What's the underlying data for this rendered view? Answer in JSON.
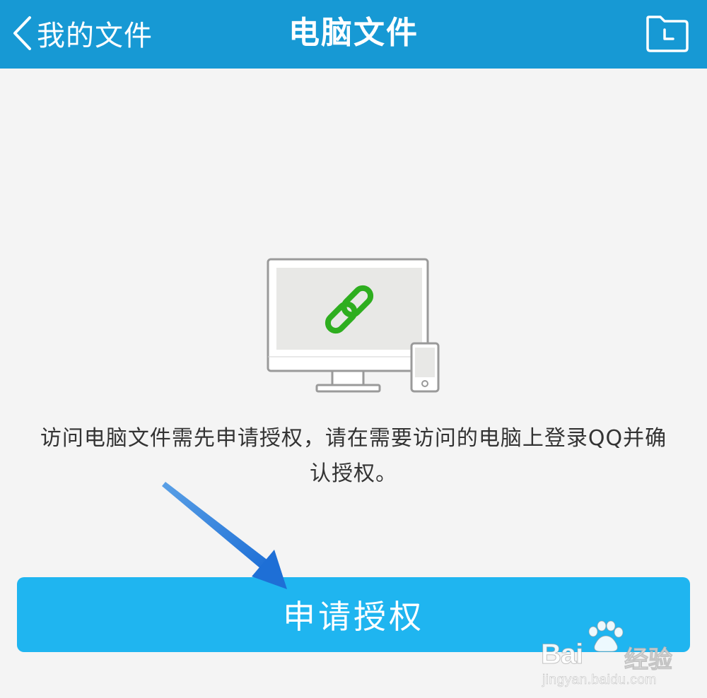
{
  "navbar": {
    "back_label": "我的文件",
    "title": "电脑文件",
    "back_icon": "chevron-left-icon",
    "right_icon": "folder-clock-icon"
  },
  "illustration": {
    "icon": "computer-phone-link-icon",
    "link_color": "#2eae1f"
  },
  "message": {
    "line1": "访问电脑文件需先申请授权，请在需要访问的电脑上登录QQ并确",
    "line2": "认授权。"
  },
  "apply_button": {
    "label": "申请授权"
  },
  "annotation": {
    "icon": "blue-arrow-icon"
  },
  "watermark": {
    "brand": "Bai",
    "product": "经验",
    "url": "jingyan.baidu.com"
  },
  "colors": {
    "navbar": "#1799d4",
    "button": "#1fb5f0",
    "background": "#f4f4f4",
    "text": "#333333"
  }
}
